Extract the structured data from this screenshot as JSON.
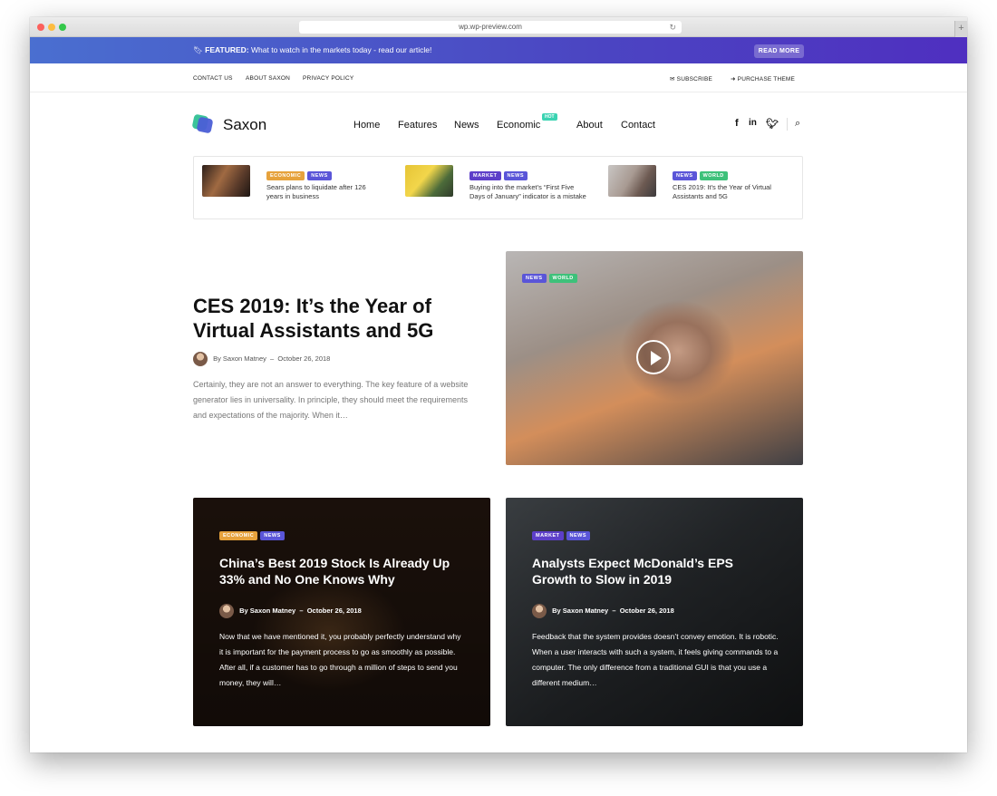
{
  "browser": {
    "url": "wp.wp-preview.com"
  },
  "featured": {
    "label": "FEATURED:",
    "text": "What to watch in the markets today  - read our article!",
    "button": "READ MORE"
  },
  "topbar": {
    "links": [
      "CONTACT US",
      "ABOUT SAXON",
      "PRIVACY POLICY"
    ],
    "subscribe": "SUBSCRIBE",
    "purchase": "PURCHASE THEME"
  },
  "header": {
    "logo": "Saxon",
    "nav": [
      "Home",
      "Features",
      "News",
      "Economic",
      "About",
      "Contact"
    ],
    "hot_badge": "HOT"
  },
  "ticker": [
    {
      "tags": [
        "ECONOMIC",
        "NEWS"
      ],
      "title": "Sears plans to liquidate after 126 years in business"
    },
    {
      "tags": [
        "MARKET",
        "NEWS"
      ],
      "title": "Buying into the market’s “First Five Days of January” indicator is a mistake"
    },
    {
      "tags": [
        "NEWS",
        "WORLD"
      ],
      "title": "CES 2019: It’s the Year of Virtual Assistants and 5G"
    }
  ],
  "hero": {
    "title": "CES 2019: It’s the Year of Virtual Assistants and 5G",
    "author": "By Saxon Matney",
    "date": "October 26, 2018",
    "excerpt": "Certainly, they are not an answer to everything. The key feature of a website generator lies in universality. In principle, they should meet the requirements and expectations of the majority. When it…",
    "tags": [
      "NEWS",
      "WORLD"
    ]
  },
  "cards": [
    {
      "tags": [
        "ECONOMIC",
        "NEWS"
      ],
      "title": "China’s Best 2019 Stock Is Already Up 33% and No One Knows Why",
      "author": "By Saxon Matney",
      "date": "October 26, 2018",
      "excerpt": "Now that we have mentioned it, you probably perfectly understand why it is important for the payment process to go as smoothly as possible. After all, if a customer has to go through a million of steps to send you money, they will…"
    },
    {
      "tags": [
        "MARKET",
        "NEWS"
      ],
      "title": "Analysts Expect McDonald’s EPS Growth to Slow in 2019",
      "author": "By Saxon Matney",
      "date": "October 26, 2018",
      "excerpt": "Feedback that the system provides doesn’t convey emotion. It is robotic. When a user interacts with such a system, it feels giving commands to a computer. The only difference from a traditional GUI is that you use a different medium…"
    }
  ]
}
